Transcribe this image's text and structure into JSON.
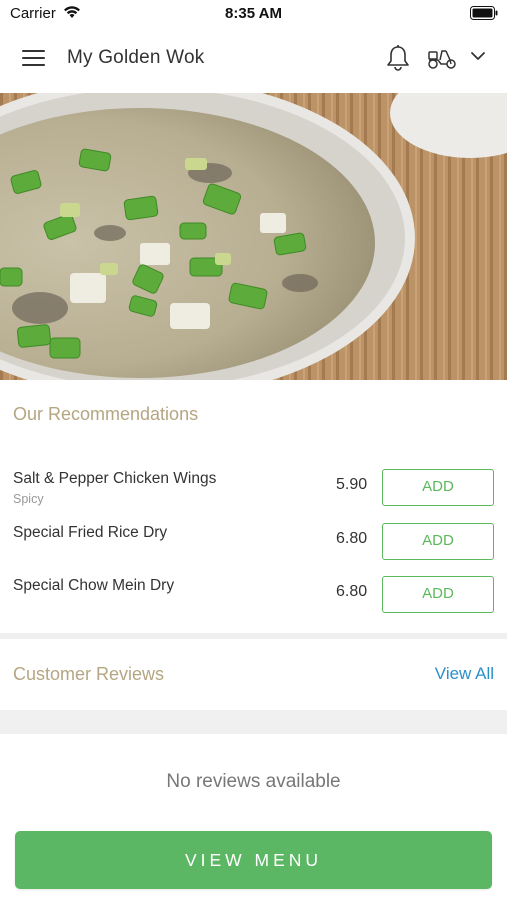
{
  "status_bar": {
    "carrier": "Carrier",
    "time": "8:35 AM"
  },
  "header": {
    "title": "My Golden Wok",
    "icons": [
      "menu-icon",
      "bell-icon",
      "scooter-icon",
      "chevron-down-icon"
    ]
  },
  "hero": {
    "icon": "soup-photo"
  },
  "recommendations": {
    "title": "Our Recommendations",
    "items": [
      {
        "name": "Salt & Pepper Chicken Wings",
        "subtitle": "Spicy",
        "price": "5.90",
        "action": "ADD"
      },
      {
        "name": "Special Fried Rice Dry",
        "subtitle": "",
        "price": "6.80",
        "action": "ADD"
      },
      {
        "name": "Special Chow Mein Dry",
        "subtitle": "",
        "price": "6.80",
        "action": "ADD"
      }
    ]
  },
  "reviews": {
    "title": "Customer Reviews",
    "view_all": "View All",
    "empty_message": "No reviews available"
  },
  "footer": {
    "view_menu": "VIEW MENU"
  },
  "colors": {
    "accent_green": "#5cb764",
    "section_title": "#b5a683",
    "link_blue": "#2b8fc9"
  }
}
